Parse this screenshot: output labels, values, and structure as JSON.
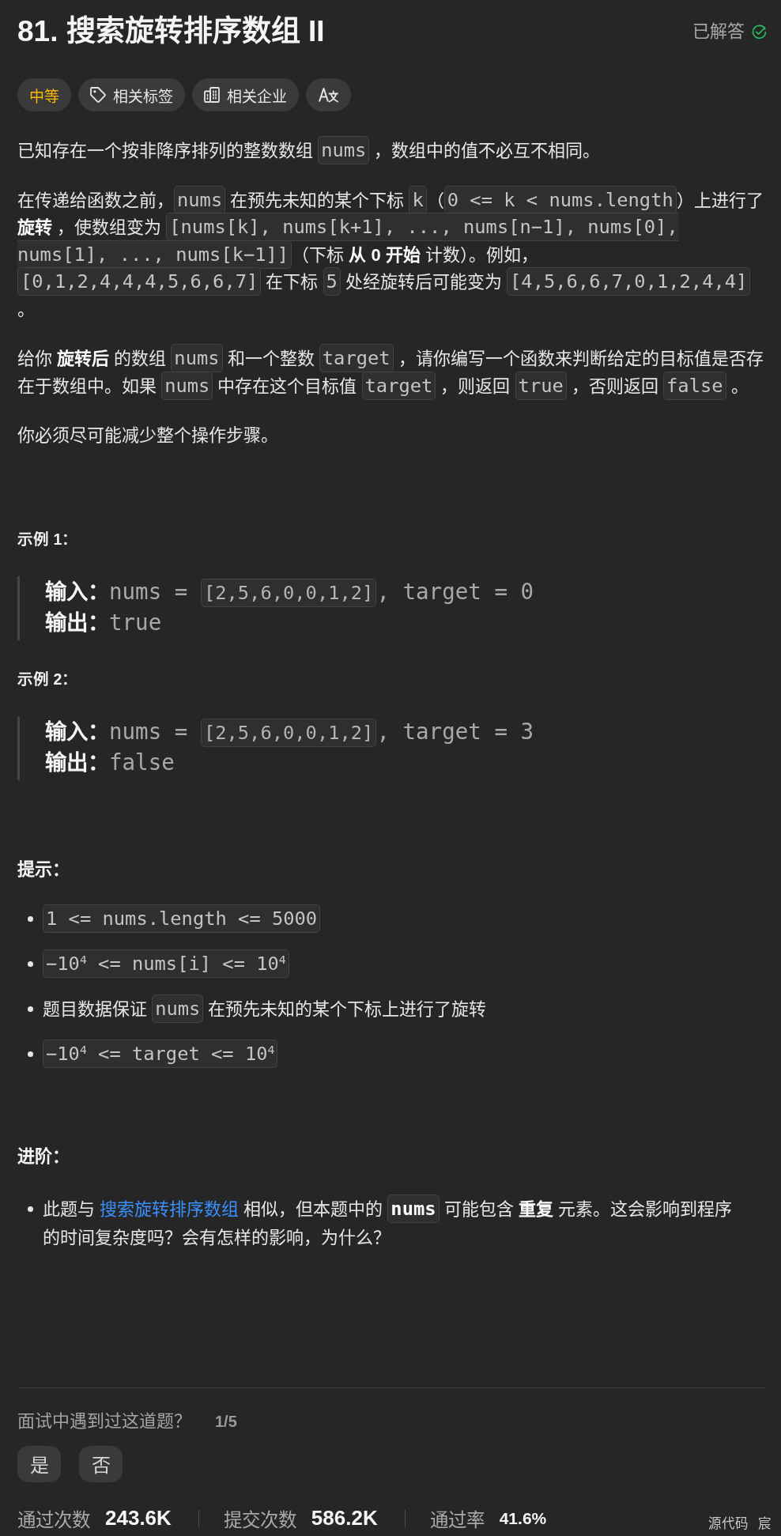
{
  "header": {
    "title": "81. 搜索旋转排序数组 II",
    "status": "已解答",
    "solved": true
  },
  "tags": [
    {
      "kind": "difficulty",
      "label": "中等"
    },
    {
      "kind": "topics",
      "label": "相关标签"
    },
    {
      "kind": "companies",
      "label": "相关企业"
    },
    {
      "kind": "translate"
    }
  ],
  "description": [
    [
      {
        "kind": "text",
        "text": "已知存在一个按非降序排列的整数数组 "
      },
      {
        "kind": "code",
        "text": "nums"
      },
      {
        "kind": "text",
        "text": " ，数组中的值不必互不相同。"
      }
    ],
    [
      {
        "kind": "text",
        "text": "在传递给函数之前，"
      },
      {
        "kind": "code",
        "text": "nums"
      },
      {
        "kind": "text",
        "text": " 在预先未知的某个下标 "
      },
      {
        "kind": "code",
        "text": "k"
      },
      {
        "kind": "text",
        "text": "（"
      },
      {
        "kind": "code",
        "text": "0 <= k < nums.length"
      },
      {
        "kind": "text",
        "text": "）上进行了**旋转** ，使数组变为 "
      },
      {
        "kind": "code",
        "text": "[nums[k], nums[k+1], ..., nums[n−1], nums[0], nums[1], ..., nums[k−1]]"
      },
      {
        "kind": "text",
        "text": "（下标 **从 0 开始** 计数）。例如，"
      },
      {
        "kind": "code",
        "text": "[0,1,2,4,4,4,5,6,6,7]"
      },
      {
        "kind": "text",
        "text": " 在下标 "
      },
      {
        "kind": "code",
        "text": "5"
      },
      {
        "kind": "text",
        "text": " 处经旋转后可能变为 "
      },
      {
        "kind": "code",
        "text": "[4,5,6,6,7,0,1,2,4,4]"
      },
      {
        "kind": "text",
        "text": " 。"
      }
    ],
    [
      {
        "kind": "text",
        "text": "给你 **旋转后** 的数组 "
      },
      {
        "kind": "code",
        "text": "nums"
      },
      {
        "kind": "text",
        "text": " 和一个整数 "
      },
      {
        "kind": "code",
        "text": "target"
      },
      {
        "kind": "text",
        "text": " ，请你编写一个函数来判断给定的目标值是否存在于数组中。如果 "
      },
      {
        "kind": "code",
        "text": "nums"
      },
      {
        "kind": "text",
        "text": " 中存在这个目标值 "
      },
      {
        "kind": "code",
        "text": "target"
      },
      {
        "kind": "text",
        "text": " ，则返回 "
      },
      {
        "kind": "code",
        "text": "true"
      },
      {
        "kind": "text",
        "text": " ，否则返回 "
      },
      {
        "kind": "code",
        "text": "false"
      },
      {
        "kind": "text",
        "text": " 。"
      }
    ],
    [
      {
        "kind": "text",
        "text": "你必须尽可能减少整个操作步骤。"
      }
    ]
  ],
  "examples": [
    {
      "title": "示例 1：",
      "lines": [
        {
          "label": "输入：",
          "value": [
            {
              "kind": "text",
              "text": "nums = "
            },
            {
              "kind": "code",
              "text": "[2,5,6,0,0,1,2]"
            },
            {
              "kind": "text",
              "text": ", target = 0"
            }
          ]
        },
        {
          "label": "输出：",
          "value": [
            {
              "kind": "text",
              "text": "true"
            }
          ]
        }
      ]
    },
    {
      "title": "示例 2：",
      "lines": [
        {
          "label": "输入：",
          "value": [
            {
              "kind": "text",
              "text": "nums = "
            },
            {
              "kind": "code",
              "text": "[2,5,6,0,0,1,2]"
            },
            {
              "kind": "text",
              "text": ", target = 3"
            }
          ]
        },
        {
          "label": "输出：",
          "value": [
            {
              "kind": "text",
              "text": "false"
            }
          ]
        }
      ]
    }
  ],
  "constraints": {
    "title": "提示：",
    "items": [
      [
        {
          "kind": "code",
          "text": "1 <= nums.length <= 5000"
        }
      ],
      [
        {
          "kind": "code",
          "text": "−10$^{4}$ <= nums[i] <= 10$^{4}$"
        }
      ],
      [
        {
          "kind": "text",
          "text": "题目数据保证 "
        },
        {
          "kind": "code",
          "text": "nums"
        },
        {
          "kind": "text",
          "text": " 在预先未知的某个下标上进行了旋转"
        }
      ],
      [
        {
          "kind": "code",
          "text": "−10$^{4}$ <= target <= 10$^{4}$"
        }
      ]
    ]
  },
  "follow_up": {
    "title": "进阶：",
    "items": [
      [
        {
          "kind": "text",
          "text": "此题与 "
        },
        {
          "kind": "link",
          "text": "搜索旋转排序数组"
        },
        {
          "kind": "text",
          "text": " 相似，但本题中的 "
        },
        {
          "kind": "code",
          "text": "**nums**"
        },
        {
          "kind": "text",
          "text": " 可能包含 **重复** 元素。这会影响到程序的时间复杂度吗？会有怎样的影响，为什么？"
        }
      ]
    ]
  },
  "interview": {
    "question": "面试中遇到过这道题？",
    "count": "1/5",
    "options": [
      {
        "label": "是",
        "selected": false
      },
      {
        "label": "否",
        "selected": false
      }
    ]
  },
  "stats": [
    {
      "kind": "count",
      "label": "通过次数",
      "value": "243.6K"
    },
    {
      "kind": "count",
      "label": "提交次数",
      "value": "586.2K"
    },
    {
      "kind": "rate",
      "label": "通过率",
      "value": "41.6%"
    }
  ],
  "corner_labels": [
    "源代码",
    "宸"
  ]
}
